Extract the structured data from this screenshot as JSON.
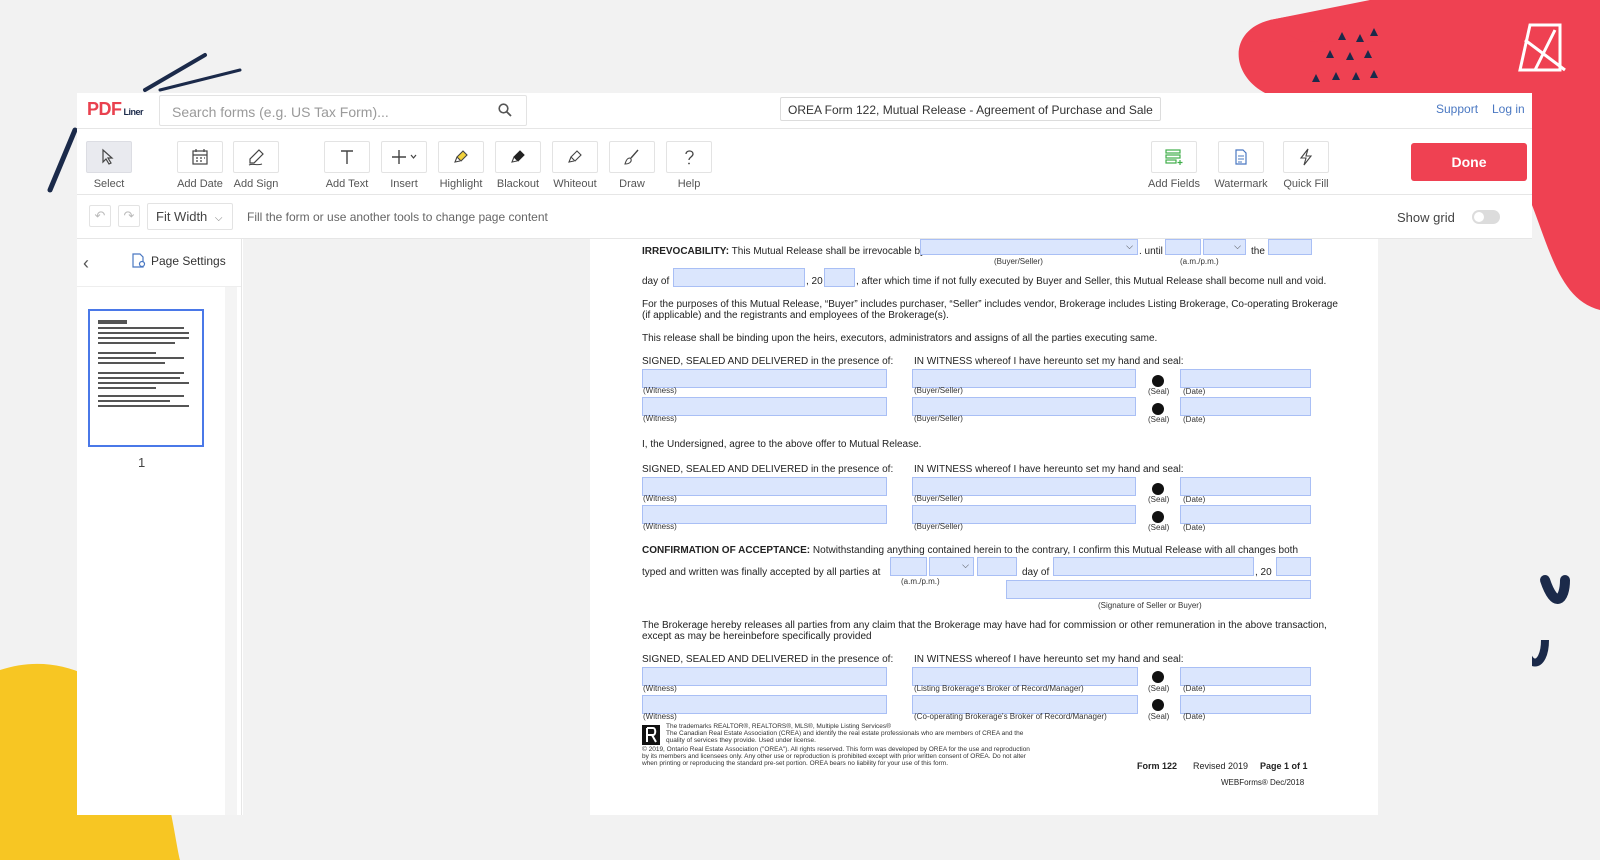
{
  "header": {
    "logo_text": "PDF",
    "logo_sub": "Liner",
    "search_placeholder": "Search forms (e.g. US Tax Form)...",
    "document_title": "OREA Form 122, Mutual Release - Agreement of Purchase and Sale",
    "support_label": "Support",
    "login_label": "Log in"
  },
  "toolbar": {
    "select": "Select",
    "add_date": "Add Date",
    "add_sign": "Add Sign",
    "add_text": "Add Text",
    "insert": "Insert",
    "highlight": "Highlight",
    "blackout": "Blackout",
    "whiteout": "Whiteout",
    "draw": "Draw",
    "help": "Help",
    "add_fields": "Add Fields",
    "watermark": "Watermark",
    "quick_fill": "Quick Fill",
    "done": "Done"
  },
  "subbar": {
    "zoom": "Fit Width",
    "hint": "Fill the form or use another tools to change page content",
    "show_grid": "Show grid"
  },
  "sidebar": {
    "page_settings": "Page Settings",
    "page_number": "1"
  },
  "doc": {
    "irrevocability_bold": "IRREVOCABILITY:",
    "irrevocability_text": "This Mutual Release shall be irrevocable by",
    "buyer_seller": "(Buyer/Seller)",
    "until": ". until",
    "ampm": "(a.m./p.m.)",
    "the": "the",
    "day_of": "day of",
    "comma20": ", 20",
    "after_text": ", after which time if not fully executed by Buyer and Seller, this Mutual Release shall become null and void.",
    "purposes_1": "For the purposes of this Mutual Release, “Buyer” includes purchaser, “Seller” includes vendor, Brokerage includes Listing Brokerage, Co-operating Brokerage",
    "purposes_2": "(if applicable) and the registrants and employees of the Brokerage(s).",
    "binding": "This release shall be binding upon the heirs, executors, administrators and assigns of all the parties executing same.",
    "signed": "SIGNED, SEALED AND DELIVERED in the presence of:",
    "witness_whereof": "IN WITNESS whereof I have hereunto set my hand and seal:",
    "witness": "(Witness)",
    "buyer_seller_label": "(Buyer/Seller)",
    "seal": "(Seal)",
    "date": "(Date)",
    "undersigned": "I, the Undersigned, agree to the above offer to Mutual Release.",
    "confirmation_bold": "CONFIRMATION OF ACCEPTANCE:",
    "confirmation_text": "Notwithstanding anything contained herein to the contrary, I confirm this Mutual Release with all changes both",
    "typed": "typed and written was finally accepted by all parties  at",
    "signature_of": "(Signature of Seller or Buyer)",
    "brokerage_1": "The Brokerage hereby releases all parties from any claim that the Brokerage may have had for commission or other remuneration in the above transaction,",
    "brokerage_2": "except as may be hereinbefore specifically provided",
    "listing_broker": "(Listing Brokerage's Broker of Record/Manager)",
    "coop_broker": "(Co-operating Brokerage's Broker of Record/Manager)",
    "fine_1": "The trademarks REALTOR®, REALTORS®, MLS®, Multiple Listing Services®",
    "fine_2": "The Canadian Real Estate Association (CREA) and identify the real estate professionals who are members of CREA and the",
    "fine_3": "quality of services they provide. Used under license.",
    "fine_4": "© 2019, Ontario Real Estate Association (\"OREA\"). All rights reserved. This form was developed by OREA for the use and reproduction",
    "fine_5": "by its members and licensees only. Any other use or reproduction is prohibited except with prior written consent of OREA. Do not alter",
    "fine_6": "when printing or reproducing the standard pre-set portion. OREA bears no liability for your use of this form.",
    "form_no": "Form 122",
    "revised": "Revised 2019",
    "page_of": "Page 1 of 1",
    "webforms": "WEBForms® Dec/2018"
  },
  "colors": {
    "accent_red": "#ef4152",
    "field_fill": "#dbe6fd",
    "link_blue": "#4a78c2",
    "deco_yellow": "#f7c623",
    "deco_navy": "#1b2a4a"
  }
}
